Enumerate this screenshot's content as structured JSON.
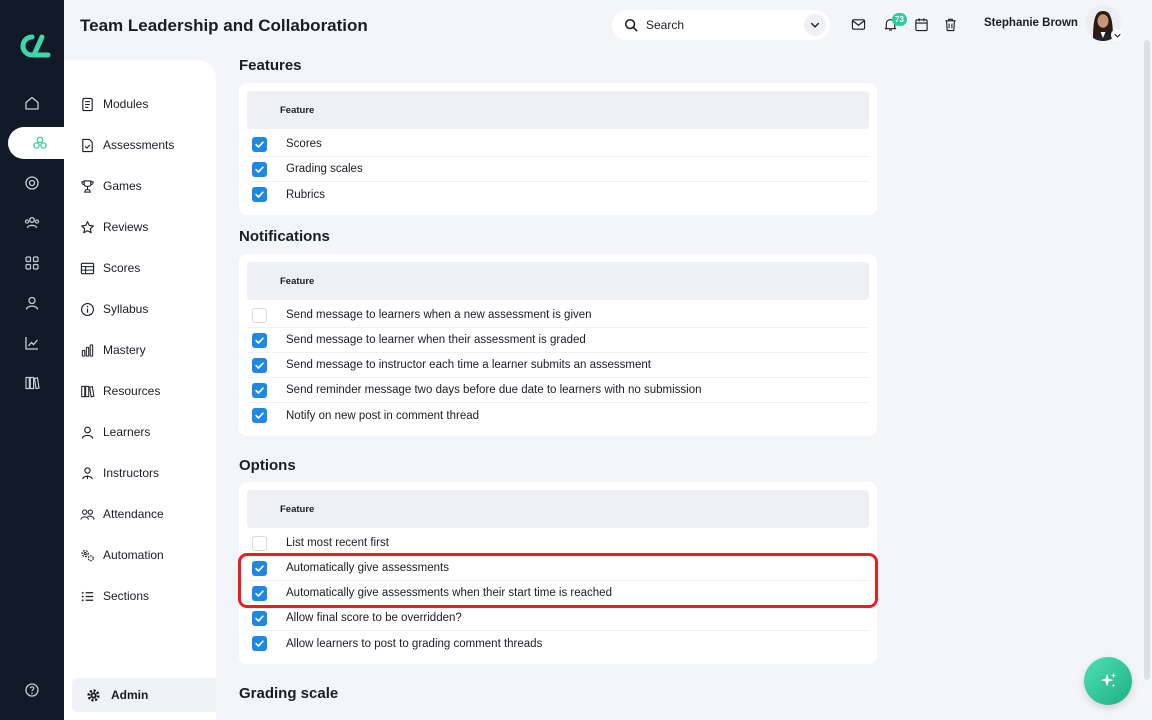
{
  "header": {
    "title": "Team Leadership and Collaboration",
    "search_placeholder": "Search",
    "notification_count": "73",
    "user_name": "Stephanie Brown"
  },
  "rail": {
    "icons": [
      "home-icon",
      "modules-icon",
      "target-icon",
      "people-icon",
      "grid-icon",
      "user-icon",
      "chart-icon",
      "library-icon"
    ]
  },
  "subnav": {
    "items": [
      {
        "label": "Modules",
        "icon": "document-icon"
      },
      {
        "label": "Assessments",
        "icon": "file-check-icon"
      },
      {
        "label": "Games",
        "icon": "trophy-icon"
      },
      {
        "label": "Reviews",
        "icon": "star-icon"
      },
      {
        "label": "Scores",
        "icon": "table-icon"
      },
      {
        "label": "Syllabus",
        "icon": "info-icon"
      },
      {
        "label": "Mastery",
        "icon": "bars-icon"
      },
      {
        "label": "Resources",
        "icon": "books-icon"
      },
      {
        "label": "Learners",
        "icon": "user-icon"
      },
      {
        "label": "Instructors",
        "icon": "instructor-icon"
      },
      {
        "label": "Attendance",
        "icon": "group-icon"
      },
      {
        "label": "Automation",
        "icon": "gears-icon"
      },
      {
        "label": "Sections",
        "icon": "list-icon"
      }
    ],
    "admin_label": "Admin"
  },
  "sections": {
    "features": {
      "title": "Features",
      "column_header": "Feature",
      "rows": [
        {
          "label": "Scores",
          "checked": true
        },
        {
          "label": "Grading scales",
          "checked": true
        },
        {
          "label": "Rubrics",
          "checked": true
        }
      ]
    },
    "notifications": {
      "title": "Notifications",
      "column_header": "Feature",
      "rows": [
        {
          "label": "Send message to learners when a new assessment is given",
          "checked": false
        },
        {
          "label": "Send message to learner when their assessment is graded",
          "checked": true
        },
        {
          "label": "Send message to instructor each time a learner submits an assessment",
          "checked": true
        },
        {
          "label": "Send reminder message two days before due date to learners with no submission",
          "checked": true
        },
        {
          "label": "Notify on new post in comment thread",
          "checked": true
        }
      ]
    },
    "options": {
      "title": "Options",
      "column_header": "Feature",
      "rows": [
        {
          "label": "List most recent first",
          "checked": false
        },
        {
          "label": "Automatically give assessments",
          "checked": true
        },
        {
          "label": "Automatically give assessments when their start time is reached",
          "checked": true
        },
        {
          "label": "Allow final score to be overridden?",
          "checked": true
        },
        {
          "label": "Allow learners to post to grading comment threads",
          "checked": true
        }
      ]
    },
    "grading_scale": {
      "title": "Grading scale"
    }
  },
  "colors": {
    "accent": "#2ecc9b",
    "checkbox": "#1e88e5",
    "rail": "#111827",
    "highlight": "#ec1c24"
  }
}
